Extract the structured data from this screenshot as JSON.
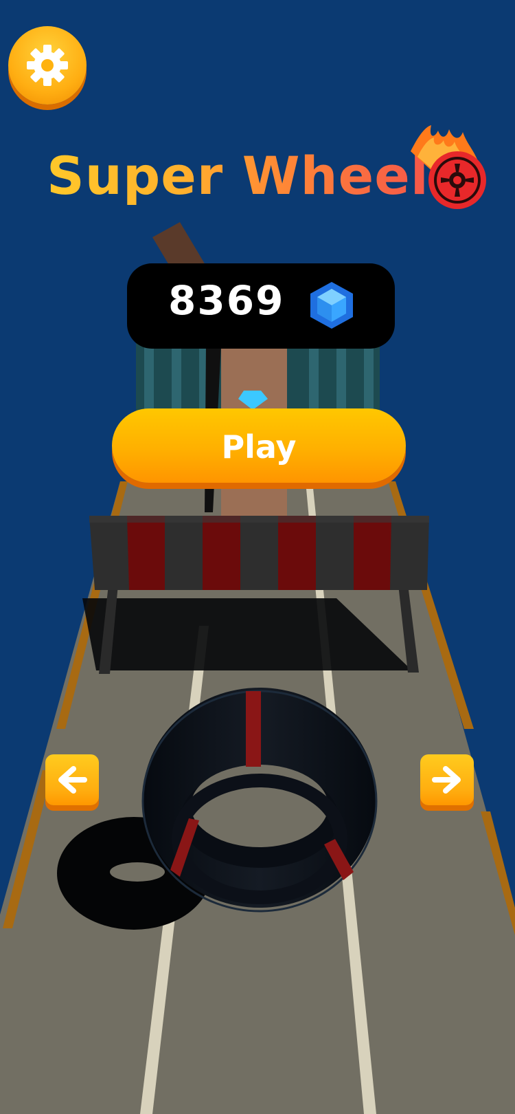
{
  "settings": {
    "icon": "gear-icon"
  },
  "title": {
    "text": "Super Wheel",
    "icon": "flaming-wheel-icon"
  },
  "currency": {
    "count": "8369",
    "icon": "blue-gem-icon"
  },
  "play": {
    "label": "Play"
  },
  "controls": {
    "left_icon": "arrow-left-icon",
    "right_icon": "arrow-right-icon"
  },
  "colors": {
    "background": "#0b3a72",
    "button_orange": "#ffb000",
    "road": "#726f63"
  }
}
